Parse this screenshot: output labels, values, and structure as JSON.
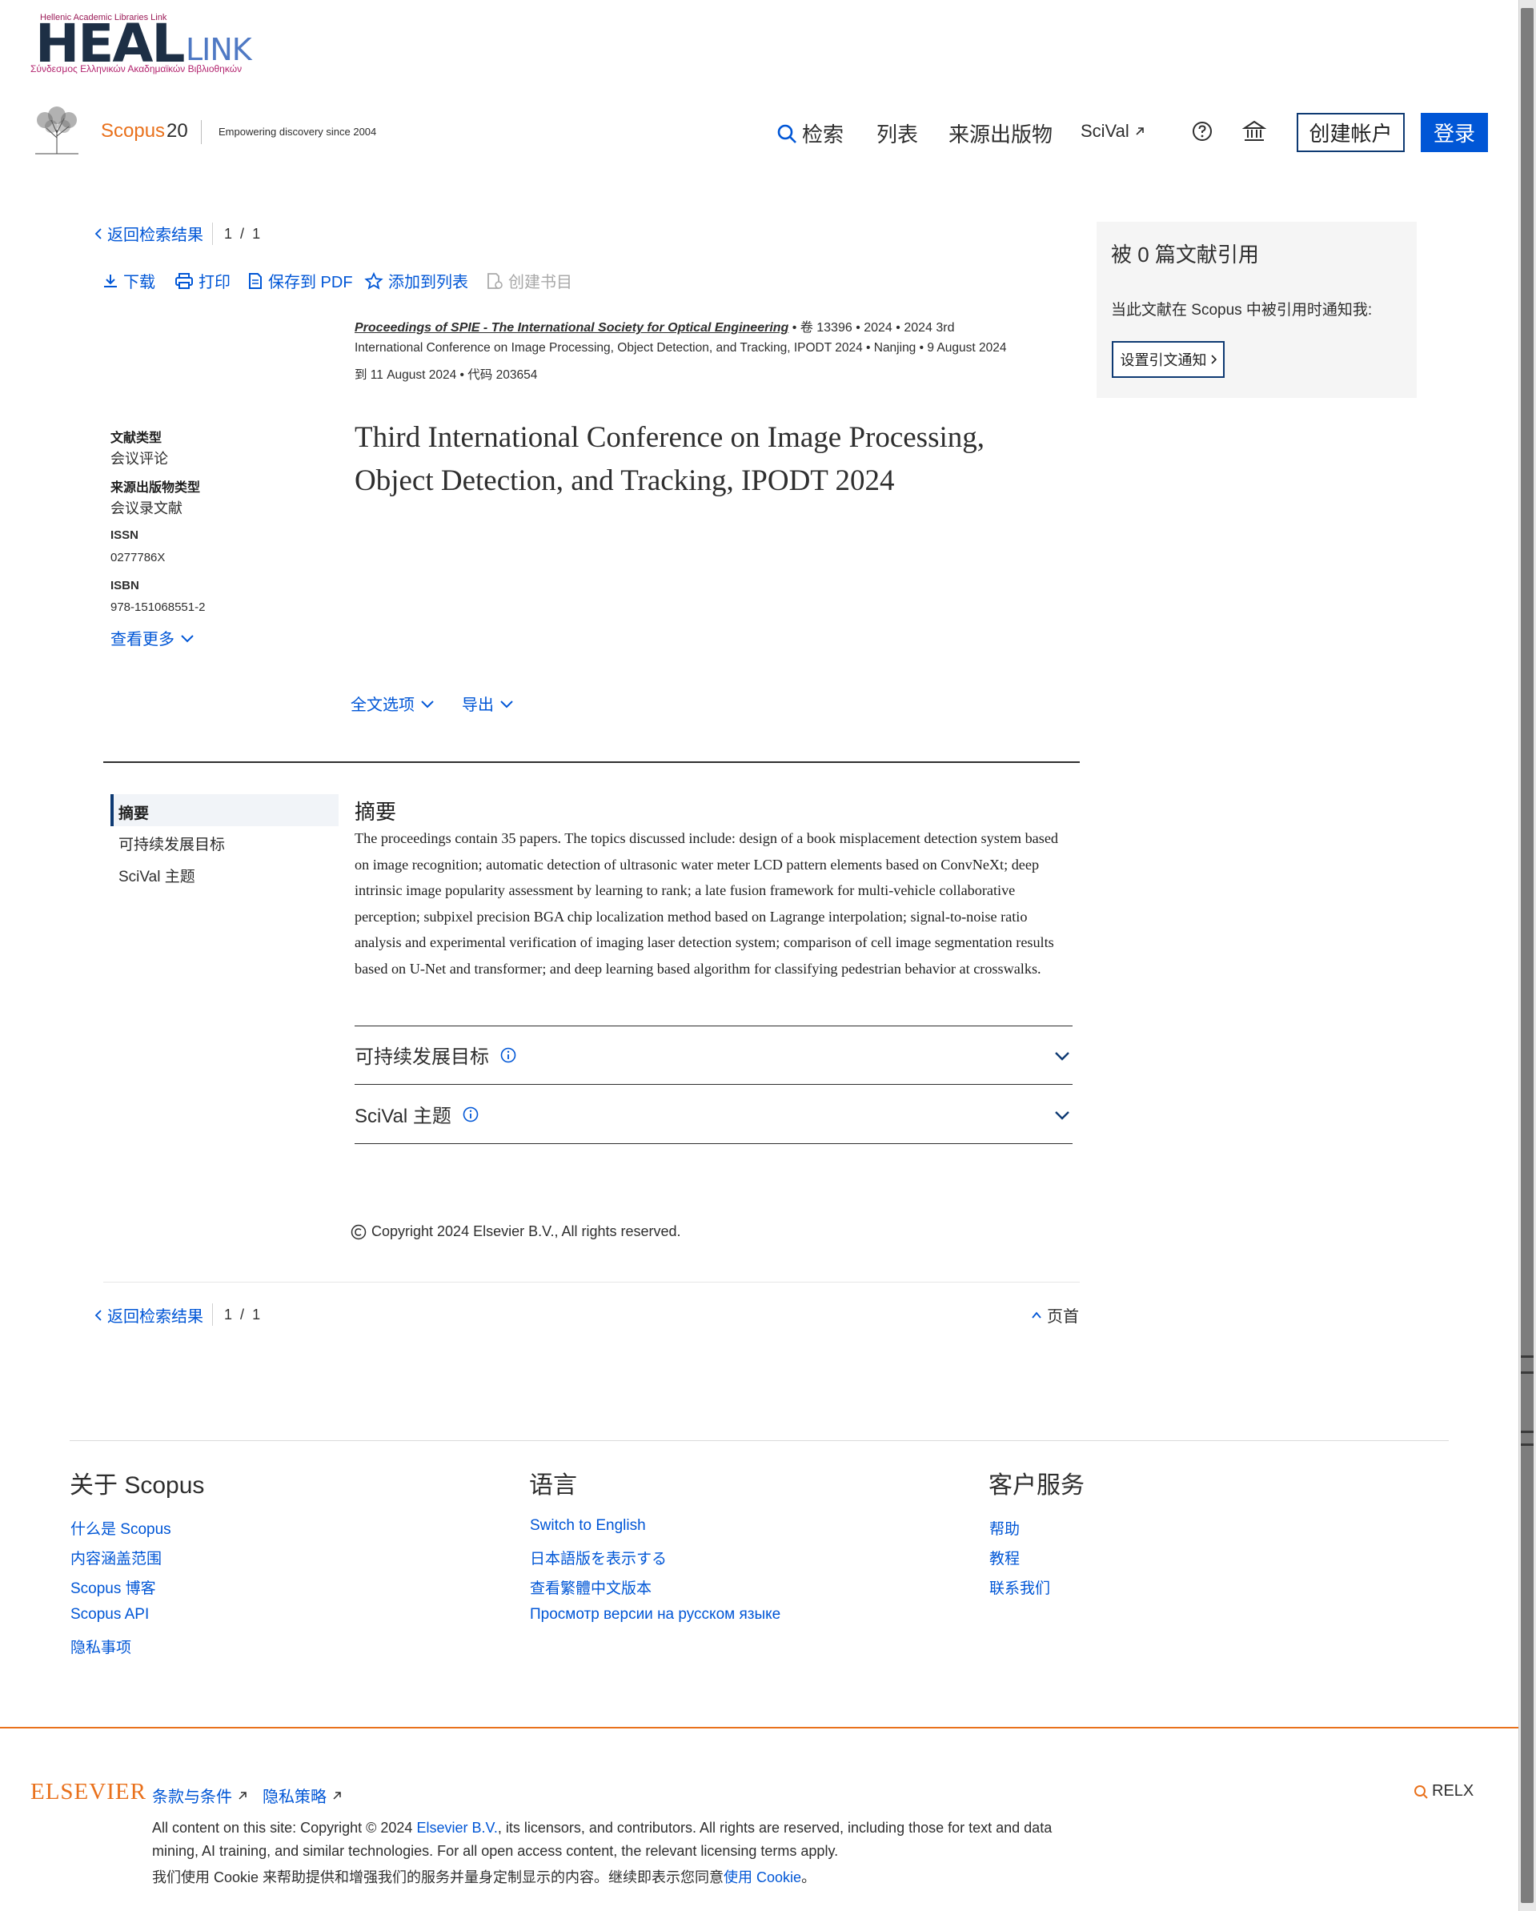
{
  "heal": {
    "top_line": "Hellenic Academic Libraries Link",
    "big": "HEAL",
    "link": "LINK",
    "sub": "Σύνδεσμος Ελληνικών Ακαδημαϊκών Βιβλιοθηκών"
  },
  "header": {
    "scopus": "Scopus",
    "scopus_num": "20",
    "tagline": "Empowering discovery since 2004",
    "nav": {
      "search": "检索",
      "lists": "列表",
      "sources": "来源出版物",
      "scival": "SciVal"
    },
    "create_account": "创建帐户",
    "login": "登录"
  },
  "toolbar": {
    "back": "返回检索结果",
    "page_current": "1",
    "page_sep": "/",
    "page_total": "1",
    "download": "下载",
    "print": "打印",
    "save_pdf": "保存到 PDF",
    "add_list": "添加到列表",
    "create_bib": "创建书目"
  },
  "citation": {
    "title": "被 0 篇文献引用",
    "desc": "当此文献在 Scopus 中被引用时通知我:",
    "button": "设置引文通知"
  },
  "source": {
    "journal": "Proceedings of SPIE - The International Society for Optical Engineering",
    "line1_rest": " • 卷 13396 • 2024 • 2024 3rd",
    "line2": "International Conference on Image Processing, Object Detection, and Tracking, IPODT 2024 • Nanjing • 9 August 2024",
    "line3": "到 11 August 2024 • 代码 203654"
  },
  "document": {
    "title": "Third International Conference on Image Processing, Object Detection, and Tracking, IPODT 2024"
  },
  "meta": {
    "doc_type_label": "文献类型",
    "doc_type": "会议评论",
    "source_type_label": "来源出版物类型",
    "source_type": "会议录文献",
    "issn_label": "ISSN",
    "issn": "0277786X",
    "isbn_label": "ISBN",
    "isbn": "978-151068551-2",
    "see_more": "查看更多"
  },
  "actions": {
    "full_text": "全文选项",
    "export": "导出"
  },
  "side_nav": {
    "abstract": "摘要",
    "sdg": "可持续发展目标",
    "scival": "SciVal 主题"
  },
  "abstract": {
    "heading": "摘要",
    "text": "The proceedings contain 35 papers. The topics discussed include: design of a book misplacement detection system based on image recognition; automatic detection of ultrasonic water meter LCD pattern elements based on ConvNeXt; deep intrinsic image popularity assessment by learning to rank; a late fusion framework for multi-vehicle collaborative perception; subpixel precision BGA chip localization method based on Lagrange interpolation; signal-to-noise ratio analysis and experimental verification of imaging laser detection system; comparison of cell image segmentation results based on U-Net and transformer; and deep learning based algorithm for classifying pedestrian behavior at crosswalks."
  },
  "accordions": {
    "sdg": "可持续发展目标",
    "scival": "SciVal 主题"
  },
  "copyright": "Copyright 2024 Elsevier B.V., All rights reserved.",
  "bottom_nav": {
    "back": "返回检索结果",
    "page_current": "1",
    "page_sep": "/",
    "page_total": "1",
    "top": "页首"
  },
  "footer": {
    "about": {
      "heading": "关于 Scopus",
      "links": [
        "什么是 Scopus",
        "内容涵盖范围",
        "Scopus 博客",
        "Scopus API",
        "隐私事项"
      ]
    },
    "language": {
      "heading": "语言",
      "links": [
        "Switch to English",
        "日本語版を表示する",
        "查看繁體中文版本",
        "Просмотр версии на русском языке"
      ]
    },
    "service": {
      "heading": "客户服务",
      "links": [
        "帮助",
        "教程",
        "联系我们"
      ]
    },
    "elsevier": "ELSEVIER",
    "terms": "条款与条件",
    "privacy": "隐私策略",
    "legal1_a": "All content on this site: Copyright © 2024 ",
    "legal1_link": "Elsevier B.V.",
    "legal1_b": ", its licensors, and contributors. All rights are reserved, including those for text and data",
    "legal2": "mining, AI training, and similar technologies. For all open access content, the relevant licensing terms apply.",
    "legal3_a": "我们使用 Cookie 来帮助提供和增强我们的服务并量身定制显示的内容。继续即表示您同意",
    "legal3_link": "使用 Cookie",
    "legal3_b": "。",
    "relx": "RELX"
  },
  "colors": {
    "accent": "#0056d6",
    "brand_orange": "#e9711c",
    "navy": "#0e3a73"
  }
}
